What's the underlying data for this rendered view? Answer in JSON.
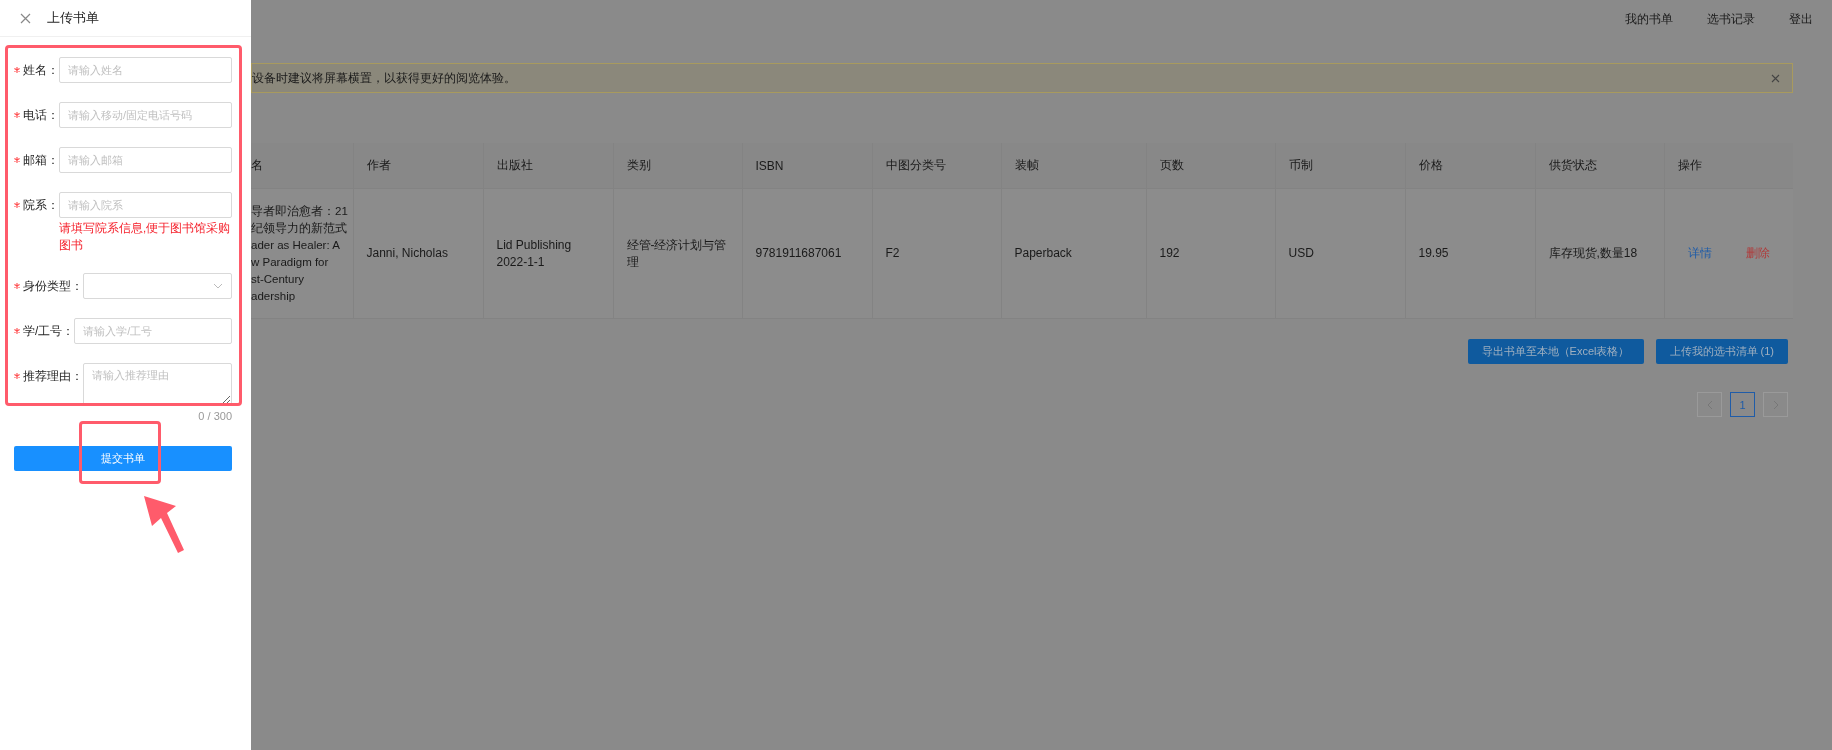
{
  "drawer": {
    "title": "上传书单",
    "fields": [
      {
        "kind": "input",
        "label": "姓名：",
        "required": true,
        "placeholder": "请输入姓名"
      },
      {
        "kind": "input",
        "label": "电话：",
        "required": true,
        "placeholder": "请输入移动/固定电话号码"
      },
      {
        "kind": "input",
        "label": "邮箱：",
        "required": true,
        "placeholder": "请输入邮箱"
      },
      {
        "kind": "input",
        "label": "院系：",
        "required": true,
        "placeholder": "请输入院系",
        "hint": "请填写院系信息,便于图书馆采购图书"
      },
      {
        "kind": "select",
        "label": "身份类型：",
        "required": true
      },
      {
        "kind": "input",
        "label": "学/工号：",
        "required": true,
        "placeholder": "请输入学/工号"
      },
      {
        "kind": "textarea",
        "label": "推荐理由：",
        "required": true,
        "placeholder": "请输入推荐理由",
        "counter": "0 / 300"
      }
    ],
    "submit": "提交书单"
  },
  "nav": [
    "我的书单",
    "选书记录",
    "登出"
  ],
  "alert": {
    "text": "设备时建议将屏幕横置，以获得更好的阅览体验。"
  },
  "table": {
    "columns": [
      "名",
      "作者",
      "出版社",
      "类别",
      "ISBN",
      "中图分类号",
      "装帧",
      "页数",
      "币制",
      "价格",
      "供货状态",
      "操作"
    ],
    "rows": [
      {
        "cells": [
          "导者即治愈者：21\n纪领导力的新范式\nader as Healer: A\nw Paradigm for\nst-Century\nadership",
          "Janni, Nicholas",
          "Lid Publishing 2022-1-1",
          "经管-经济计划与管理",
          "9781911687061",
          "F2",
          "Paperback",
          "192",
          "USD",
          "19.95",
          "库存现货,数量18"
        ],
        "actions": [
          {
            "kind": "link",
            "label": "详情"
          },
          {
            "kind": "danger",
            "label": "删除"
          }
        ]
      }
    ]
  },
  "buttons": [
    "导出书单至本地（Excel表格）",
    "上传我的选书清单 (1)"
  ],
  "pagination": {
    "pages": [
      {
        "label": "1",
        "selected": true
      }
    ]
  }
}
